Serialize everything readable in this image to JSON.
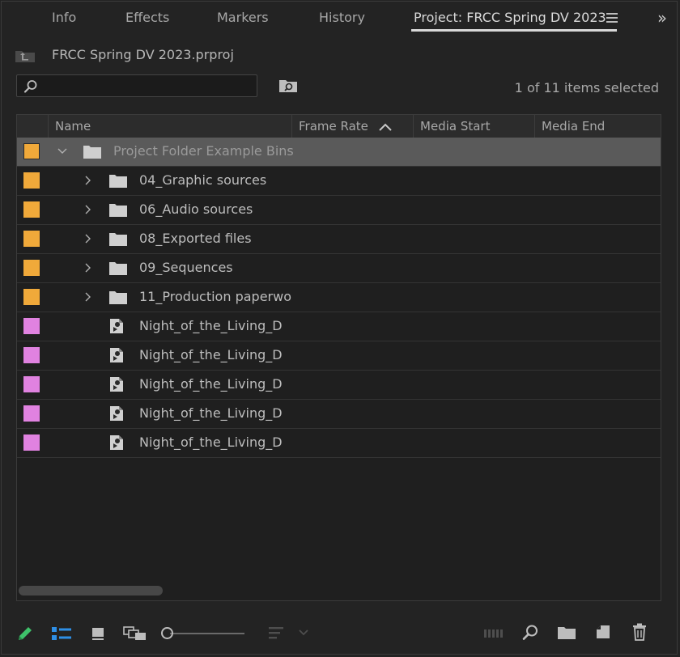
{
  "tabs": [
    {
      "label": "Info",
      "active": false
    },
    {
      "label": "Effects",
      "active": false
    },
    {
      "label": "Markers",
      "active": false
    },
    {
      "label": "History",
      "active": false
    },
    {
      "label": "Project: FRCC Spring DV 2023",
      "active": true
    }
  ],
  "project": {
    "file_name": "FRCC Spring DV 2023.prproj"
  },
  "search": {
    "value": "",
    "placeholder": ""
  },
  "selection_status": "1 of 11 items selected",
  "columns": [
    {
      "label": "Name"
    },
    {
      "label": "Frame Rate",
      "sorted": "ascending"
    },
    {
      "label": "Media Start"
    },
    {
      "label": "Media End"
    }
  ],
  "rows": [
    {
      "label": "Project Folder Example Bins",
      "type": "bin",
      "expanded": true,
      "selected": true,
      "label_color": "#f0a93a"
    },
    {
      "label": "04_Graphic sources",
      "type": "bin",
      "expanded": false,
      "selected": false,
      "label_color": "#f0a93a"
    },
    {
      "label": "06_Audio sources",
      "type": "bin",
      "expanded": false,
      "selected": false,
      "label_color": "#f0a93a"
    },
    {
      "label": "08_Exported files",
      "type": "bin",
      "expanded": false,
      "selected": false,
      "label_color": "#f0a93a"
    },
    {
      "label": "09_Sequences",
      "type": "bin",
      "expanded": false,
      "selected": false,
      "label_color": "#f0a93a"
    },
    {
      "label": "11_Production paperwo",
      "type": "bin",
      "expanded": false,
      "selected": false,
      "label_color": "#f0a93a"
    },
    {
      "label": "Night_of_the_Living_D",
      "type": "clip",
      "selected": false,
      "label_color": "#e082e0"
    },
    {
      "label": "Night_of_the_Living_D",
      "type": "clip",
      "selected": false,
      "label_color": "#e082e0"
    },
    {
      "label": "Night_of_the_Living_D",
      "type": "clip",
      "selected": false,
      "label_color": "#e082e0"
    },
    {
      "label": "Night_of_the_Living_D",
      "type": "clip",
      "selected": false,
      "label_color": "#e082e0"
    },
    {
      "label": "Night_of_the_Living_D",
      "type": "clip",
      "selected": false,
      "label_color": "#e082e0"
    }
  ],
  "toolbar": {
    "icons": [
      "pencil-icon",
      "list-view-icon",
      "icon-view-icon",
      "freeform-view-icon",
      "zoom-slider",
      "sort-icons-icon",
      "automate-to-sequence-icon",
      "find-icon",
      "new-bin-icon",
      "new-item-icon",
      "clear-icon"
    ],
    "zoom_level": 0.0
  },
  "colors": {
    "panel_bg": "#232323",
    "bin_label": "#f0a93a",
    "clip_label": "#e082e0",
    "pencil_accent": "#3ec26a",
    "list_view_accent": "#2e8fe6"
  }
}
